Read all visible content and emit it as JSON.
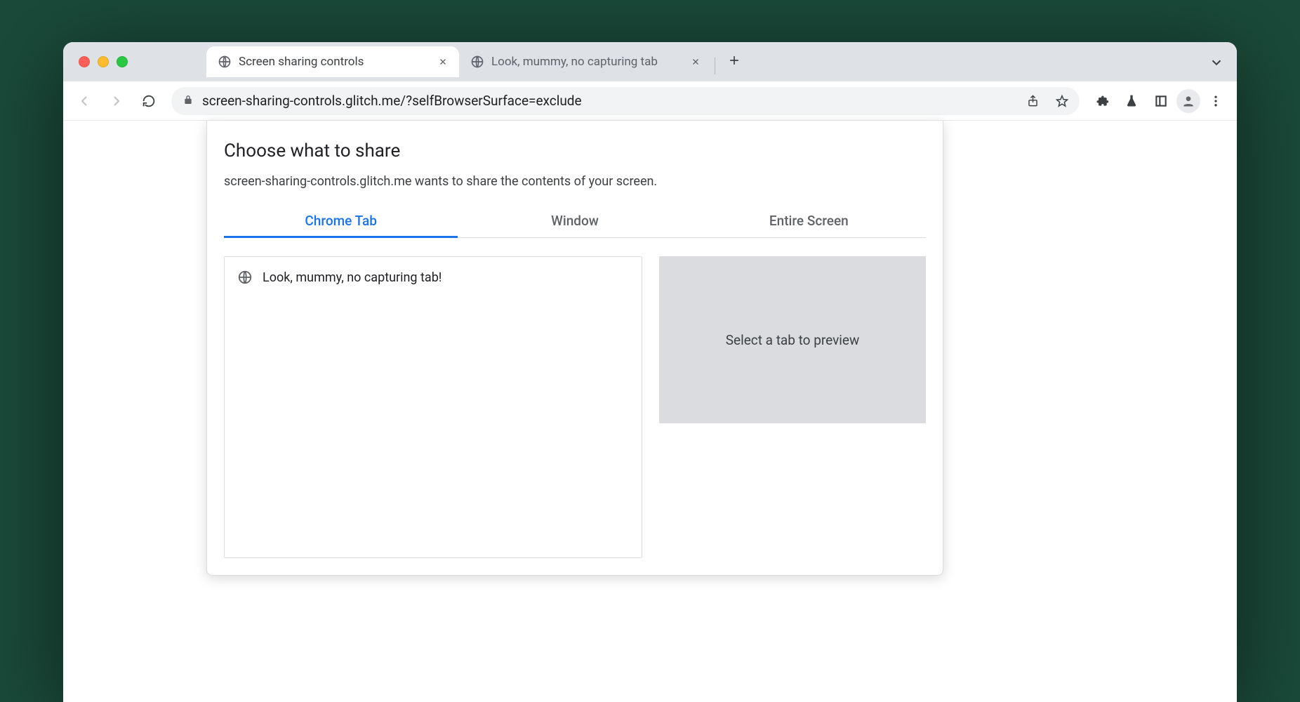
{
  "browser": {
    "tabs": [
      {
        "title": "Screen sharing controls",
        "active": true
      },
      {
        "title": "Look, mummy, no capturing tab",
        "active": false
      }
    ],
    "url": "screen-sharing-controls.glitch.me/?selfBrowserSurface=exclude"
  },
  "picker": {
    "title": "Choose what to share",
    "subtitle": "screen-sharing-controls.glitch.me wants to share the contents of your screen.",
    "tabs": {
      "chrome_tab": "Chrome Tab",
      "window": "Window",
      "entire_screen": "Entire Screen"
    },
    "items": [
      {
        "title": "Look, mummy, no capturing tab!"
      }
    ],
    "preview_placeholder": "Select a tab to preview"
  }
}
